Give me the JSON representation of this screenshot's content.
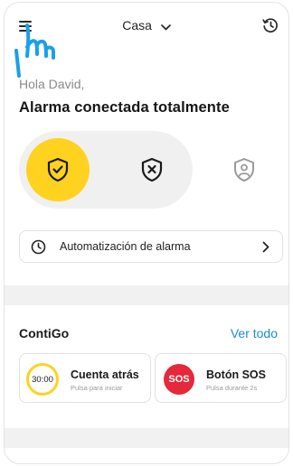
{
  "header": {
    "location_label": "Casa",
    "menu_icon": "hamburger-menu-icon",
    "location_icon": "chevron-down-icon",
    "history_icon": "history-icon"
  },
  "greeting": "Hola David,",
  "alarm_status": "Alarma conectada totalmente",
  "modes": [
    {
      "name": "armed",
      "icon": "shield-check-icon",
      "selected": true
    },
    {
      "name": "disarmed",
      "icon": "shield-x-icon",
      "selected": false
    },
    {
      "name": "partial",
      "icon": "shield-person-icon",
      "selected": false
    }
  ],
  "automation": {
    "label": "Automatización de alarma",
    "icon": "clock-icon",
    "arrow_icon": "chevron-right-icon"
  },
  "contigo": {
    "title": "ContiGo",
    "see_all": "Ver todo",
    "tiles": [
      {
        "badge": "30:00",
        "title": "Cuenta atrás",
        "subtitle": "Pulsa para iniciar"
      },
      {
        "badge": "SOS",
        "title": "Botón SOS",
        "subtitle": "Pulsa durante 2s"
      }
    ]
  },
  "colors": {
    "accent_yellow": "#ffd21f",
    "link_blue": "#1b8ccf",
    "sos_red": "#e5283a",
    "cursor_blue": "#1aa0e8"
  }
}
